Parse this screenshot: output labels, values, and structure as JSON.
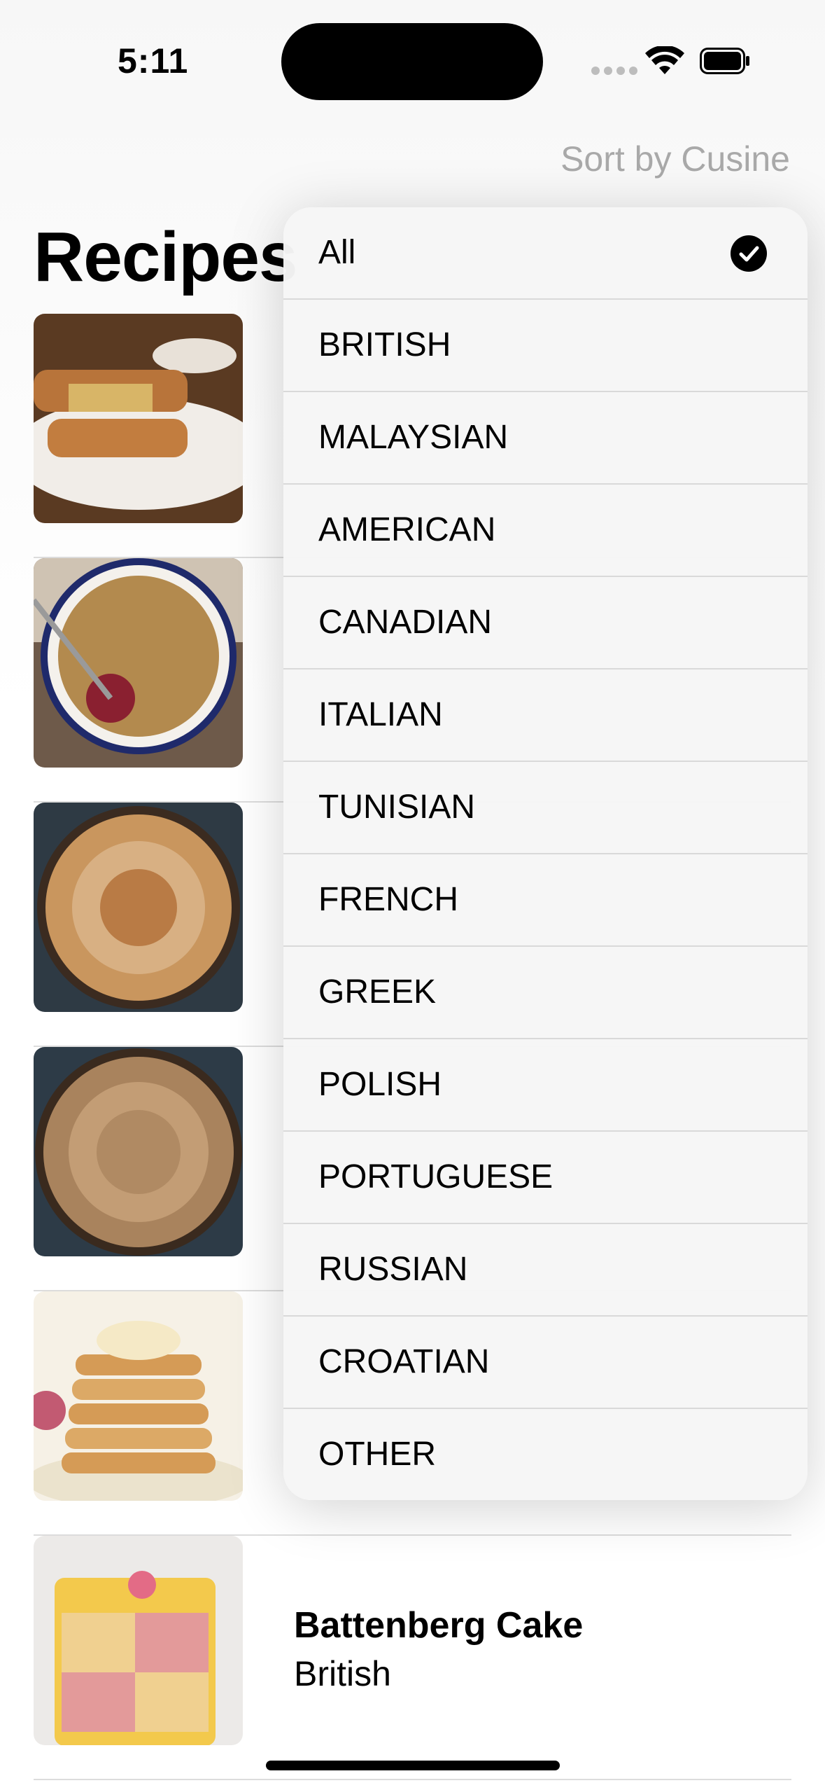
{
  "status_bar": {
    "time": "5:11"
  },
  "nav": {
    "sort_label": "Sort by Cusine",
    "title": "Recipes"
  },
  "recipes": [
    {
      "name": "",
      "cuisine": ""
    },
    {
      "name": "",
      "cuisine": ""
    },
    {
      "name": "",
      "cuisine": ""
    },
    {
      "name": "",
      "cuisine": ""
    },
    {
      "name": "",
      "cuisine": ""
    },
    {
      "name": "Battenberg Cake",
      "cuisine": "British"
    }
  ],
  "menu": {
    "selected": "All",
    "items": [
      {
        "label": "All"
      },
      {
        "label": "BRITISH"
      },
      {
        "label": "MALAYSIAN"
      },
      {
        "label": "AMERICAN"
      },
      {
        "label": "CANADIAN"
      },
      {
        "label": "ITALIAN"
      },
      {
        "label": "TUNISIAN"
      },
      {
        "label": "FRENCH"
      },
      {
        "label": "GREEK"
      },
      {
        "label": "POLISH"
      },
      {
        "label": "PORTUGUESE"
      },
      {
        "label": "RUSSIAN"
      },
      {
        "label": "CROATIAN"
      },
      {
        "label": "OTHER"
      }
    ]
  }
}
